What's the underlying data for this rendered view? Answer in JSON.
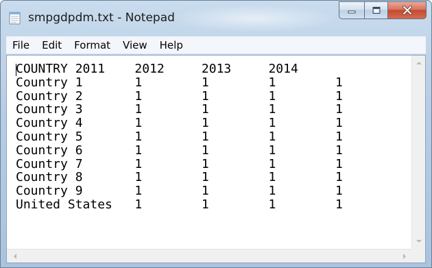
{
  "window": {
    "title": "smpgdpdm.txt - Notepad",
    "app_icon": "notepad-icon",
    "controls": {
      "minimize_icon": "minimize-icon",
      "maximize_icon": "maximize-icon",
      "close_icon": "close-icon"
    }
  },
  "menu": {
    "items": [
      {
        "label": "File"
      },
      {
        "label": "Edit"
      },
      {
        "label": "Format"
      },
      {
        "label": "View"
      },
      {
        "label": "Help"
      }
    ]
  },
  "editor": {
    "text": "COUNTRY 2011    2012     2013     2014\nCountry 1       1        1        1        1\nCountry 2       1        1        1        1\nCountry 3       1        1        1        1\nCountry 4       1        1        1        1\nCountry 5       1        1        1        1\nCountry 6       1        1        1        1\nCountry 7       1        1        1        1\nCountry 8       1        1        1        1\nCountry 9       1        1        1        1\nUnited States   1        1        1        1"
  },
  "colors": {
    "titlebar": "#b7cde4",
    "close_button": "#c44a31",
    "menubar": "#f3f6fb",
    "editor_bg": "#ffffff"
  }
}
